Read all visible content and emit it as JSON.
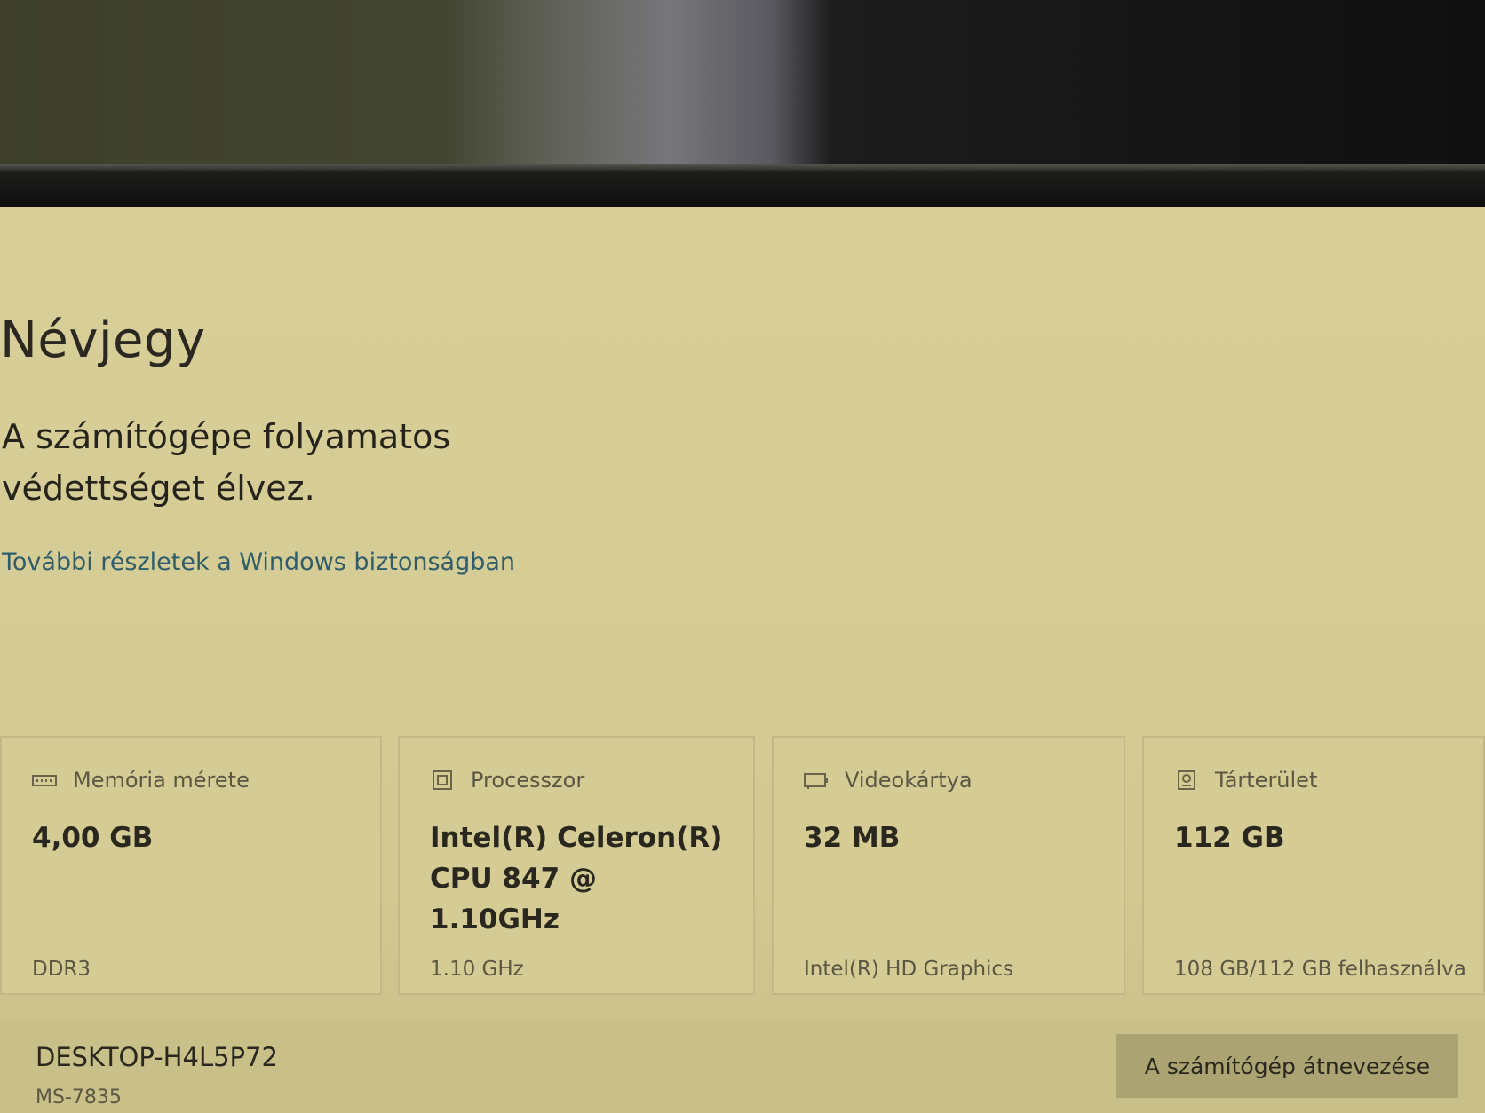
{
  "about": {
    "title": "Névjegy",
    "protection_status": "A számítógépe folyamatos védettséget élvez.",
    "security_link": "További részletek a Windows biztonságban"
  },
  "specs": [
    {
      "label": "Memória mérete",
      "value": "4,00 GB",
      "detail": "DDR3",
      "icon": "memory-icon"
    },
    {
      "label": "Processzor",
      "value": "Intel(R) Celeron(R) CPU 847 @ 1.10GHz",
      "detail": "1.10 GHz",
      "icon": "processor-icon"
    },
    {
      "label": "Videokártya",
      "value": "32 MB",
      "detail": "Intel(R) HD Graphics",
      "icon": "graphics-card-icon"
    },
    {
      "label": "Tárterület",
      "value": "112 GB",
      "detail": "108 GB/112 GB felhasználva",
      "icon": "storage-icon"
    }
  ],
  "device": {
    "name": "DESKTOP-H4L5P72",
    "model": "MS-7835",
    "rename_button": "A számítógép átnevezése"
  },
  "colors": {
    "screen_background": "#d6cc96",
    "link": "#2f5d6a",
    "button": "#aca372"
  }
}
